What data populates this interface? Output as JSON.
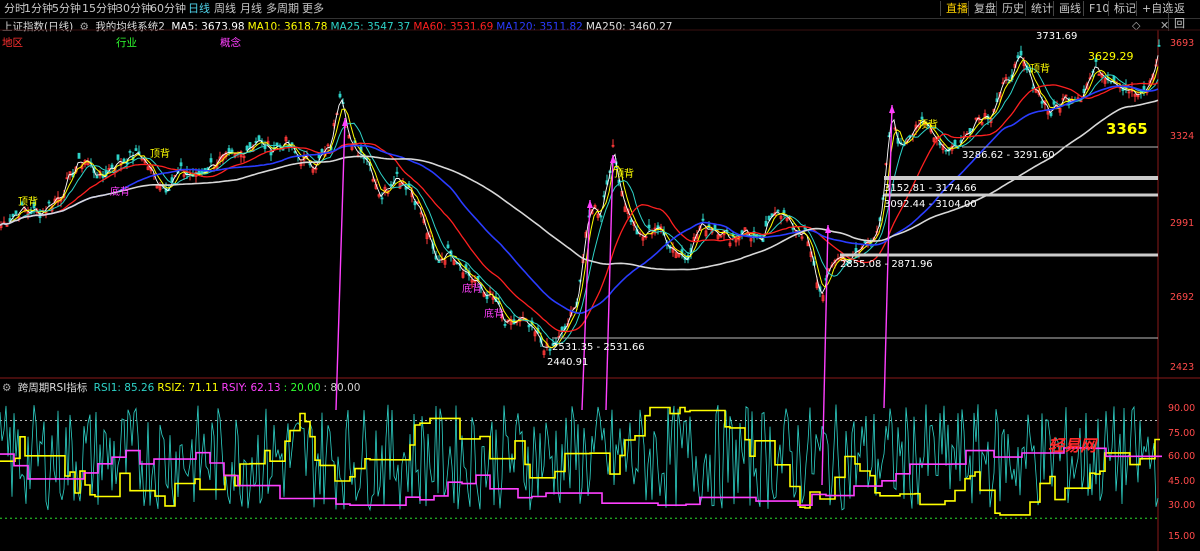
{
  "toolbar": {
    "left": [
      "分时",
      "1分钟",
      "5分钟",
      "15分钟",
      "30分钟",
      "60分钟",
      "日线",
      "周线",
      "月线",
      "多周期",
      "更多"
    ],
    "active": "日线",
    "right": [
      "直播",
      "复盘",
      "历史",
      "统计",
      "画线",
      "F10",
      "+自选",
      "返回"
    ],
    "right_active": "直播",
    "mark_label": "标记"
  },
  "legend": {
    "title": "上证指数(日线)",
    "system": "我的均线系统2",
    "ma": [
      {
        "label": "MA5: 3673.98",
        "color": "#ffffff"
      },
      {
        "label": "MA10: 3618.78",
        "color": "#ffff00"
      },
      {
        "label": "MA25: 3547.37",
        "color": "#2ed3c8"
      },
      {
        "label": "MA60: 3531.69",
        "color": "#ff2020"
      },
      {
        "label": "MA120: 3511.82",
        "color": "#2a3cff"
      },
      {
        "label": "MA250: 3460.27",
        "color": "#e0e0e0"
      }
    ]
  },
  "categories": [
    {
      "label": "地区",
      "color": "#ff3030"
    },
    {
      "label": "行业",
      "color": "#30ff30"
    },
    {
      "label": "概念",
      "color": "#ff40ff"
    }
  ],
  "price_axis": [
    "3693",
    "3324",
    "2991",
    "2692",
    "2423"
  ],
  "rsi_axis": [
    "90.00",
    "75.00",
    "60.00",
    "45.00",
    "30.00",
    "15.00"
  ],
  "annotations": {
    "high": "3731.69",
    "peak2": "3629.29",
    "big": "3365",
    "low": "2440.91",
    "zone1": "2531.35 - 2531.66",
    "zone2": "3286.62 - 3291.60",
    "zone3": "3152.81 - 3174.66",
    "zone4": "3092.44 - 3104.00",
    "zone5": "2855.08 - 2871.96",
    "diverge1": "顶背",
    "diverge2": "底背",
    "diverge3": "顶背",
    "diverge4": "底背",
    "diverge5": "底背",
    "diverge6": "顶背",
    "diverge7": "顶背",
    "diverge8": "顶背",
    "watermark": "轻易网"
  },
  "rsi_legend": {
    "title": "跨周期RSI指标",
    "items": [
      {
        "label": "RSI1: 85.26",
        "color": "#2ed3c8"
      },
      {
        "label": "RSIZ: 71.11",
        "color": "#ffff00"
      },
      {
        "label": "RSIY: 62.13",
        "color": "#ff40ff"
      },
      {
        "label": ": 20.00",
        "color": "#30ff30"
      },
      {
        "label": ": 80.00",
        "color": "#d0d0d0"
      }
    ]
  },
  "chart_data": {
    "type": "line",
    "title": "上证指数(日线)",
    "y_range": [
      2423,
      3750
    ],
    "x_count": 290,
    "close_series_anchors": [
      [
        0,
        3000
      ],
      [
        20,
        3060
      ],
      [
        40,
        3050
      ],
      [
        60,
        3120
      ],
      [
        75,
        3230
      ],
      [
        85,
        3260
      ],
      [
        100,
        3180
      ],
      [
        110,
        3230
      ],
      [
        125,
        3260
      ],
      [
        140,
        3280
      ],
      [
        155,
        3180
      ],
      [
        165,
        3150
      ],
      [
        180,
        3210
      ],
      [
        195,
        3190
      ],
      [
        215,
        3250
      ],
      [
        235,
        3270
      ],
      [
        255,
        3330
      ],
      [
        270,
        3300
      ],
      [
        285,
        3320
      ],
      [
        300,
        3260
      ],
      [
        315,
        3240
      ],
      [
        330,
        3310
      ],
      [
        340,
        3550
      ],
      [
        350,
        3300
      ],
      [
        365,
        3280
      ],
      [
        380,
        3110
      ],
      [
        395,
        3200
      ],
      [
        410,
        3140
      ],
      [
        420,
        3050
      ],
      [
        435,
        2860
      ],
      [
        450,
        2900
      ],
      [
        465,
        2820
      ],
      [
        480,
        2750
      ],
      [
        495,
        2700
      ],
      [
        505,
        2600
      ],
      [
        520,
        2630
      ],
      [
        535,
        2570
      ],
      [
        548,
        2500
      ],
      [
        560,
        2560
      ],
      [
        575,
        2680
      ],
      [
        590,
        3080
      ],
      [
        600,
        3050
      ],
      [
        612,
        3290
      ],
      [
        625,
        3070
      ],
      [
        640,
        2940
      ],
      [
        655,
        3000
      ],
      [
        670,
        2920
      ],
      [
        685,
        2870
      ],
      [
        700,
        3000
      ],
      [
        715,
        2990
      ],
      [
        730,
        2950
      ],
      [
        745,
        2980
      ],
      [
        760,
        2920
      ],
      [
        775,
        3080
      ],
      [
        790,
        3000
      ],
      [
        805,
        2960
      ],
      [
        820,
        2720
      ],
      [
        835,
        2880
      ],
      [
        850,
        2860
      ],
      [
        865,
        2930
      ],
      [
        880,
        3000
      ],
      [
        890,
        3440
      ],
      [
        900,
        3300
      ],
      [
        915,
        3400
      ],
      [
        930,
        3380
      ],
      [
        945,
        3300
      ],
      [
        960,
        3320
      ],
      [
        975,
        3420
      ],
      [
        990,
        3440
      ],
      [
        1005,
        3560
      ],
      [
        1020,
        3650
      ],
      [
        1035,
        3540
      ],
      [
        1050,
        3440
      ],
      [
        1065,
        3500
      ],
      [
        1080,
        3510
      ],
      [
        1095,
        3620
      ],
      [
        1110,
        3580
      ],
      [
        1125,
        3540
      ],
      [
        1140,
        3500
      ],
      [
        1150,
        3560
      ],
      [
        1158,
        3690
      ]
    ],
    "ma_series": [
      {
        "name": "MA60",
        "color": "#ff2020"
      },
      {
        "name": "MA120",
        "color": "#2a3cff"
      },
      {
        "name": "MA250",
        "color": "#e0e0e0"
      }
    ],
    "rsi_lines": {
      "lower": 20,
      "upper": 80
    }
  }
}
